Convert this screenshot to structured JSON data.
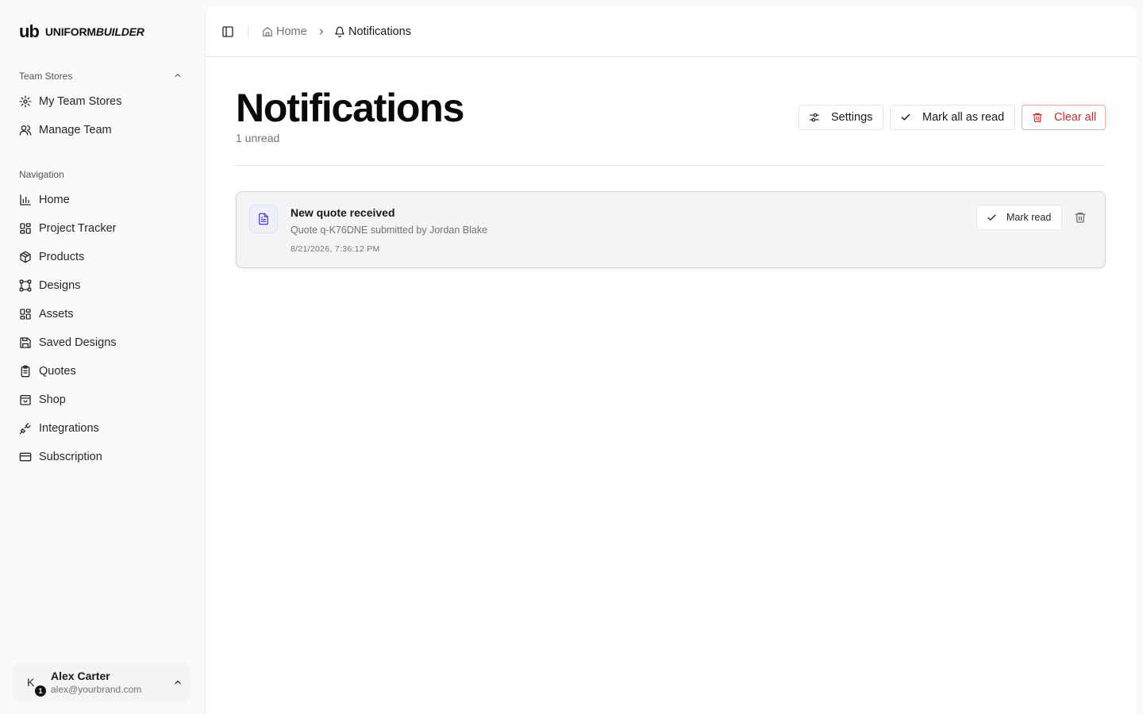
{
  "brand": {
    "mark": "ub",
    "name_plain": "UNIFORM",
    "name_italic": "BUILDER"
  },
  "sidebar": {
    "team_section": {
      "label": "Team Stores",
      "items": [
        {
          "label": "My Team Stores",
          "icon": "gear-icon"
        },
        {
          "label": "Manage Team",
          "icon": "users-icon"
        }
      ]
    },
    "nav_section": {
      "label": "Navigation",
      "items": [
        {
          "label": "Home",
          "icon": "bar-chart-icon"
        },
        {
          "label": "Project Tracker",
          "icon": "grid-icon"
        },
        {
          "label": "Products",
          "icon": "package-icon"
        },
        {
          "label": "Designs",
          "icon": "frame-icon"
        },
        {
          "label": "Assets",
          "icon": "grid-icon"
        },
        {
          "label": "Saved Designs",
          "icon": "save-icon"
        },
        {
          "label": "Quotes",
          "icon": "clipboard-icon"
        },
        {
          "label": "Shop",
          "icon": "store-icon"
        },
        {
          "label": "Integrations",
          "icon": "plug-icon"
        },
        {
          "label": "Subscription",
          "icon": "credit-card-icon"
        }
      ]
    },
    "user": {
      "initial": "K",
      "badge": "1",
      "name": "Alex Carter",
      "email": "alex@yourbrand.com"
    }
  },
  "breadcrumb": {
    "home": "Home",
    "current": "Notifications"
  },
  "page": {
    "title": "Notifications",
    "subtitle": "1 unread",
    "actions": {
      "settings": "Settings",
      "mark_all": "Mark all as read",
      "clear_all": "Clear all"
    }
  },
  "notifications": [
    {
      "title": "New quote received",
      "description": "Quote q-K76DNE submitted by Jordan Blake",
      "time": "8/21/2026, 7:36:12 PM",
      "mark_read_label": "Mark read"
    }
  ],
  "colors": {
    "danger": "#dc2626",
    "danger_border": "#f3a5a5",
    "icon_accent": "#4f46e5",
    "notif_bg": "#f4f4f5"
  }
}
